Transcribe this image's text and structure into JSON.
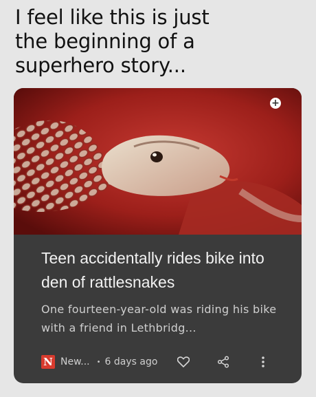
{
  "caption": "I feel like this is just\nthe beginning  of a\nsuperhero story...",
  "card": {
    "image_alt": "rattlesnake",
    "badge_icon": "plus-icon",
    "headline": "Teen accidentally rides bike into den of rattlesnakes",
    "snippet": "One fourteen-year-old was riding his bike with a friend in Lethbridg...",
    "source": {
      "logo_letter": "N",
      "name": "New...",
      "separator": "•",
      "age": "6 days ago"
    },
    "actions": {
      "like_icon": "heart-icon",
      "share_icon": "share-icon",
      "more_icon": "more-vertical-icon"
    }
  },
  "colors": {
    "background": "#e6e6e6",
    "card": "#3b3b3b",
    "source_logo": "#d83b2e"
  }
}
